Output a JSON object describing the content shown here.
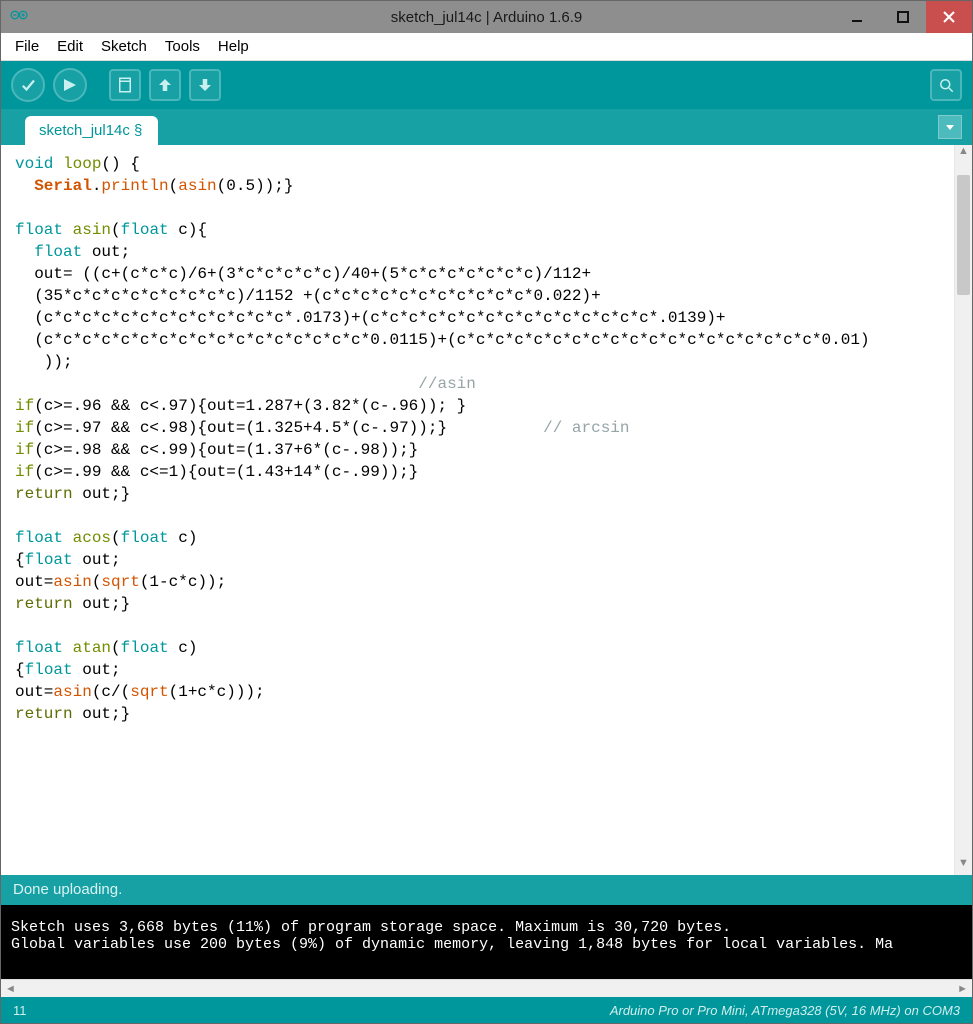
{
  "window": {
    "title": "sketch_jul14c | Arduino 1.6.9"
  },
  "menu": {
    "file": "File",
    "edit": "Edit",
    "sketch": "Sketch",
    "tools": "Tools",
    "help": "Help"
  },
  "tabs": {
    "active": "sketch_jul14c §"
  },
  "code": {
    "l01a": "void",
    "l01b": " loop",
    "l01c": "() {",
    "l02a": "  ",
    "l02b": "Serial",
    "l02c": ".",
    "l02d": "println",
    "l02e": "(",
    "l02f": "asin",
    "l02g": "(0.5));}",
    "l03": "",
    "l04a": "float",
    "l04b": " asin",
    "l04c": "(",
    "l04d": "float",
    "l04e": " c){",
    "l05a": "  ",
    "l05b": "float",
    "l05c": " out;",
    "l06": "  out= ((c+(c*c*c)/6+(3*c*c*c*c*c)/40+(5*c*c*c*c*c*c*c)/112+",
    "l07": "  (35*c*c*c*c*c*c*c*c*c)/1152 +(c*c*c*c*c*c*c*c*c*c*c*0.022)+",
    "l08": "  (c*c*c*c*c*c*c*c*c*c*c*c*c*.0173)+(c*c*c*c*c*c*c*c*c*c*c*c*c*c*c*.0139)+",
    "l09": "  (c*c*c*c*c*c*c*c*c*c*c*c*c*c*c*c*c*0.0115)+(c*c*c*c*c*c*c*c*c*c*c*c*c*c*c*c*c*c*c*0.01)",
    "l10": "   ));",
    "l11a": "                                          ",
    "l11b": "//asin",
    "l12a": "if",
    "l12b": "(c>=.96 && c<.97){out=1.287+(3.82*(c-.96)); }",
    "l13a": "if",
    "l13b": "(c>=.97 && c<.98){out=(1.325+4.5*(c-.97));}          ",
    "l13c": "// arcsin",
    "l14a": "if",
    "l14b": "(c>=.98 && c<.99){out=(1.37+6*(c-.98));}",
    "l15a": "if",
    "l15b": "(c>=.99 && c<=1){out=(1.43+14*(c-.99));}",
    "l16a": "return",
    "l16b": " out;}",
    "l17": "",
    "l18a": "float",
    "l18b": " acos",
    "l18c": "(",
    "l18d": "float",
    "l18e": " c)",
    "l19a": "{",
    "l19b": "float",
    "l19c": " out;",
    "l20a": "out=",
    "l20b": "asin",
    "l20c": "(",
    "l20d": "sqrt",
    "l20e": "(1-c*c));",
    "l21a": "return",
    "l21b": " out;}",
    "l22": "",
    "l23a": "float",
    "l23b": " atan",
    "l23c": "(",
    "l23d": "float",
    "l23e": " c)",
    "l24a": "{",
    "l24b": "float",
    "l24c": " out;",
    "l25a": "out=",
    "l25b": "asin",
    "l25c": "(c/(",
    "l25d": "sqrt",
    "l25e": "(1+c*c)));",
    "l26a": "return",
    "l26b": " out;}"
  },
  "status": {
    "message": "Done uploading."
  },
  "console": {
    "line1": "Sketch uses 3,668 bytes (11%) of program storage space. Maximum is 30,720 bytes.",
    "line2": "Global variables use 200 bytes (9%) of dynamic memory, leaving 1,848 bytes for local variables. Ma"
  },
  "bottom": {
    "line": "11",
    "board": "Arduino Pro or Pro Mini, ATmega328 (5V, 16 MHz) on COM3"
  }
}
